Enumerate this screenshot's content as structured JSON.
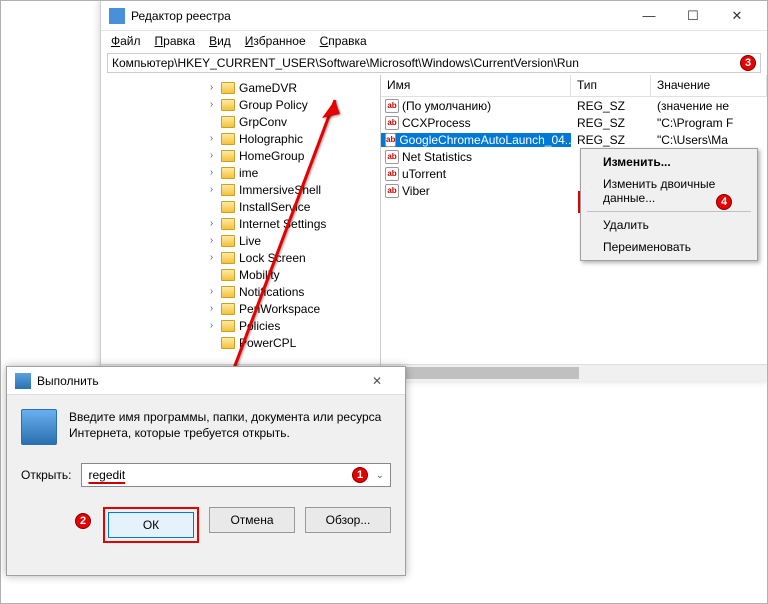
{
  "regedit": {
    "title": "Редактор реестра",
    "menu": [
      "Файл",
      "Правка",
      "Вид",
      "Избранное",
      "Справка"
    ],
    "address": "Компьютер\\HKEY_CURRENT_USER\\Software\\Microsoft\\Windows\\CurrentVersion\\Run",
    "tree": [
      {
        "exp": "›",
        "label": "GameDVR"
      },
      {
        "exp": "›",
        "label": "Group Policy"
      },
      {
        "exp": "",
        "label": "GrpConv"
      },
      {
        "exp": "›",
        "label": "Holographic"
      },
      {
        "exp": "›",
        "label": "HomeGroup"
      },
      {
        "exp": "›",
        "label": "ime"
      },
      {
        "exp": "›",
        "label": "ImmersiveShell"
      },
      {
        "exp": "",
        "label": "InstallService"
      },
      {
        "exp": "›",
        "label": "Internet Settings"
      },
      {
        "exp": "›",
        "label": "Live"
      },
      {
        "exp": "›",
        "label": "Lock Screen"
      },
      {
        "exp": "",
        "label": "Mobility"
      },
      {
        "exp": "›",
        "label": "Notifications"
      },
      {
        "exp": "›",
        "label": "PenWorkspace"
      },
      {
        "exp": "›",
        "label": "Policies"
      },
      {
        "exp": "",
        "label": "PowerCPL"
      }
    ],
    "columns": {
      "name": "Имя",
      "type": "Тип",
      "data": "Значение"
    },
    "rows": [
      {
        "name": "(По умолчанию)",
        "type": "REG_SZ",
        "data": "(значение не",
        "sel": false
      },
      {
        "name": "CCXProcess",
        "type": "REG_SZ",
        "data": "\"C:\\Program F",
        "sel": false
      },
      {
        "name": "GoogleChromeAutoLaunch_04...",
        "type": "REG_SZ",
        "data": "\"C:\\Users\\Ma",
        "sel": true
      },
      {
        "name": "Net Statistics",
        "type": "",
        "data": "",
        "sel": false
      },
      {
        "name": "uTorrent",
        "type": "",
        "data": "",
        "sel": false
      },
      {
        "name": "Viber",
        "type": "",
        "data": "",
        "sel": false
      }
    ],
    "context": {
      "modify": "Изменить...",
      "modify_bin": "Изменить двоичные данные...",
      "delete": "Удалить",
      "rename": "Переименовать"
    }
  },
  "run": {
    "title": "Выполнить",
    "desc": "Введите имя программы, папки, документа или ресурса Интернета, которые требуется открыть.",
    "open_label": "Открыть:",
    "value": "regedit",
    "ok": "ОК",
    "cancel": "Отмена",
    "browse": "Обзор..."
  },
  "markers": {
    "1": "1",
    "2": "2",
    "3": "3",
    "4": "4"
  }
}
